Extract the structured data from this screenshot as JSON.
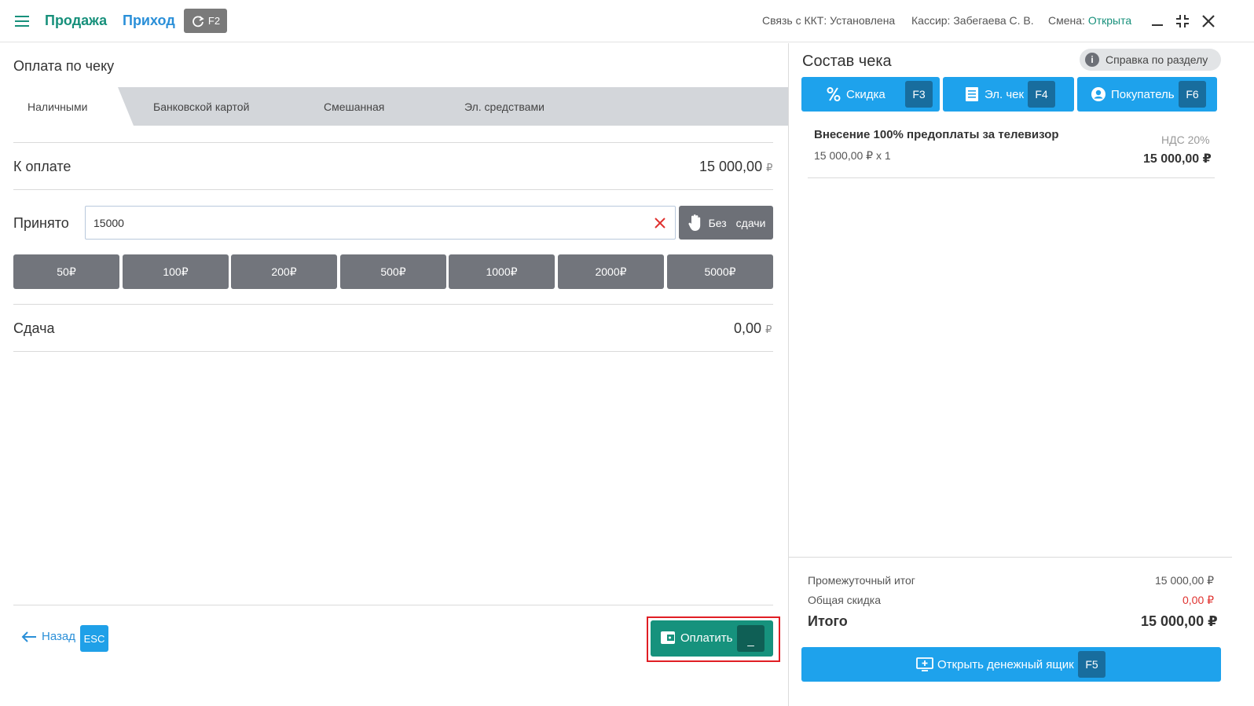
{
  "topbar": {
    "sale": "Продажа",
    "income": "Приход",
    "switch_key": "F2",
    "kkt_status_label": "Связь с ККТ: Установлена",
    "cashier": "Кассир: Забегаева С. В.",
    "shift_label": "Смена:",
    "shift_value": "Открыта"
  },
  "payment": {
    "title": "Оплата по чеку",
    "tabs": [
      {
        "label": "Наличными",
        "active": true
      },
      {
        "label": "Банковской картой",
        "active": false
      },
      {
        "label": "Смешанная",
        "active": false
      },
      {
        "label": "Эл. средствами",
        "active": false
      }
    ],
    "due_label": "К оплате",
    "due_amount": "15 000,00",
    "received_label": "Принято",
    "received_value": "15000",
    "no_change_words": [
      "Без",
      "сдачи"
    ],
    "quick_amounts": [
      "50₽",
      "100₽",
      "200₽",
      "500₽",
      "1000₽",
      "2000₽",
      "5000₽"
    ],
    "change_label": "Сдача",
    "change_amount": "0,00",
    "currency": "₽"
  },
  "footer": {
    "back_label": "Назад",
    "back_key": "ESC",
    "pay_label": "Оплатить",
    "pay_key": "_"
  },
  "receipt": {
    "title": "Состав чека",
    "help_label": "Справка по разделу",
    "buttons": [
      {
        "label": "Скидка",
        "key": "F3",
        "icon": "percent-icon"
      },
      {
        "label": "Эл. чек",
        "key": "F4",
        "icon": "receipt-icon"
      },
      {
        "label": "Покупатель",
        "key": "F6",
        "icon": "user-icon"
      }
    ],
    "items": [
      {
        "name": "Внесение 100% предоплаты за телевизор",
        "qty_line": "15 000,00 ₽ x 1",
        "vat": "НДС 20%",
        "total": "15 000,00 ₽"
      }
    ],
    "subtotal_label": "Промежуточный итог",
    "subtotal_value": "15 000,00 ₽",
    "discount_label": "Общая скидка",
    "discount_value": "0,00 ₽",
    "total_label": "Итого",
    "total_value": "15 000,00 ₽",
    "drawer_label": "Открыть денежный ящик",
    "drawer_key": "F5"
  },
  "colors": {
    "brand_green": "#17907b",
    "accent_blue": "#1ea2ec",
    "link_blue": "#2a8fd8",
    "danger_red": "#e01e24",
    "gray_button": "#72757c"
  }
}
